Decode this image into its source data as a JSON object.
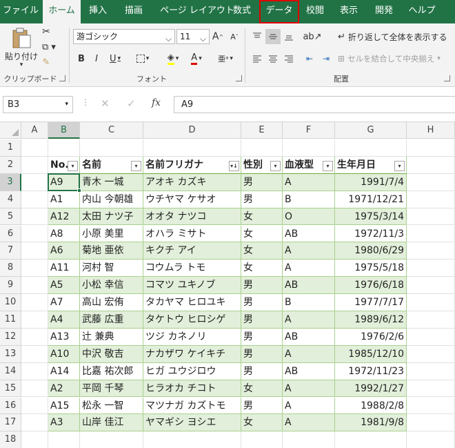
{
  "tabs": [
    {
      "label": "ファイル",
      "state": "normal"
    },
    {
      "label": "ホーム",
      "state": "active"
    },
    {
      "label": "挿入",
      "state": "normal"
    },
    {
      "label": "描画",
      "state": "normal"
    },
    {
      "label": "ページ レイアウト",
      "state": "normal"
    },
    {
      "label": "数式",
      "state": "normal"
    },
    {
      "label": "データ",
      "state": "highlighted"
    },
    {
      "label": "校閲",
      "state": "normal"
    },
    {
      "label": "表示",
      "state": "normal"
    },
    {
      "label": "開発",
      "state": "normal"
    },
    {
      "label": "ヘルプ",
      "state": "normal"
    }
  ],
  "ribbon": {
    "clipboard": {
      "paste_label": "貼り付け",
      "group_label": "クリップボード"
    },
    "font": {
      "font_name": "游ゴシック",
      "font_size": "11",
      "group_label": "フォント",
      "bold": "B",
      "italic": "I",
      "underline": "U",
      "font_color_label": "A"
    },
    "alignment": {
      "wrap_text_label": "折り返して全体を表示する",
      "merge_label": "セルを結合して中央揃え",
      "group_label": "配置"
    }
  },
  "formula_bar": {
    "name_box": "B3",
    "fx_label": "fx",
    "value": "A9"
  },
  "columns": [
    "A",
    "B",
    "C",
    "D",
    "E",
    "F",
    "G",
    "H"
  ],
  "selected_column": "B",
  "rows": [
    "1",
    "2",
    "3",
    "4",
    "5",
    "6",
    "7",
    "8",
    "9",
    "10",
    "11",
    "12",
    "13",
    "14",
    "15",
    "16",
    "17",
    "18"
  ],
  "selected_row": "3",
  "table": {
    "headers": [
      "No.",
      "名前",
      "名前フリガナ",
      "性別",
      "血液型",
      "生年月日"
    ],
    "rows": [
      [
        "A9",
        "青木 一城",
        "アオキ カズキ",
        "男",
        "A",
        "1991/7/4"
      ],
      [
        "A1",
        "内山 今朝雄",
        "ウチヤマ ケサオ",
        "男",
        "B",
        "1971/12/21"
      ],
      [
        "A12",
        "太田 ナツ子",
        "オオタ ナツコ",
        "女",
        "O",
        "1975/3/14"
      ],
      [
        "A8",
        "小原 美里",
        "オハラ ミサト",
        "女",
        "AB",
        "1972/11/3"
      ],
      [
        "A6",
        "菊地 亜依",
        "キクチ アイ",
        "女",
        "A",
        "1980/6/29"
      ],
      [
        "A11",
        "河村 智",
        "コウムラ トモ",
        "女",
        "A",
        "1975/5/18"
      ],
      [
        "A5",
        "小松 幸信",
        "コマツ ユキノブ",
        "男",
        "AB",
        "1976/6/18"
      ],
      [
        "A7",
        "高山 宏侑",
        "タカヤマ ヒロユキ",
        "男",
        "B",
        "1977/7/17"
      ],
      [
        "A4",
        "武藤 広重",
        "タケトウ ヒロシゲ",
        "男",
        "A",
        "1989/6/12"
      ],
      [
        "A13",
        "辻 兼典",
        "ツジ カネノリ",
        "男",
        "AB",
        "1976/2/6"
      ],
      [
        "A10",
        "中沢 敬吉",
        "ナカザワ ケイキチ",
        "男",
        "A",
        "1985/12/10"
      ],
      [
        "A14",
        "比嘉 祐次郎",
        "ヒガ ユウジロウ",
        "男",
        "AB",
        "1972/11/23"
      ],
      [
        "A2",
        "平岡 千琴",
        "ヒラオカ チコト",
        "女",
        "A",
        "1992/1/27"
      ],
      [
        "A15",
        "松永 一智",
        "マツナガ カズトモ",
        "男",
        "A",
        "1988/2/8"
      ],
      [
        "A3",
        "山岸 佳江",
        "ヤマギシ ヨシエ",
        "女",
        "A",
        "1981/9/8"
      ]
    ],
    "sorted_column": "名前フリガナ"
  },
  "colors": {
    "accent": "#217346",
    "band": "#e2efda",
    "highlight_border": "#e00000"
  }
}
